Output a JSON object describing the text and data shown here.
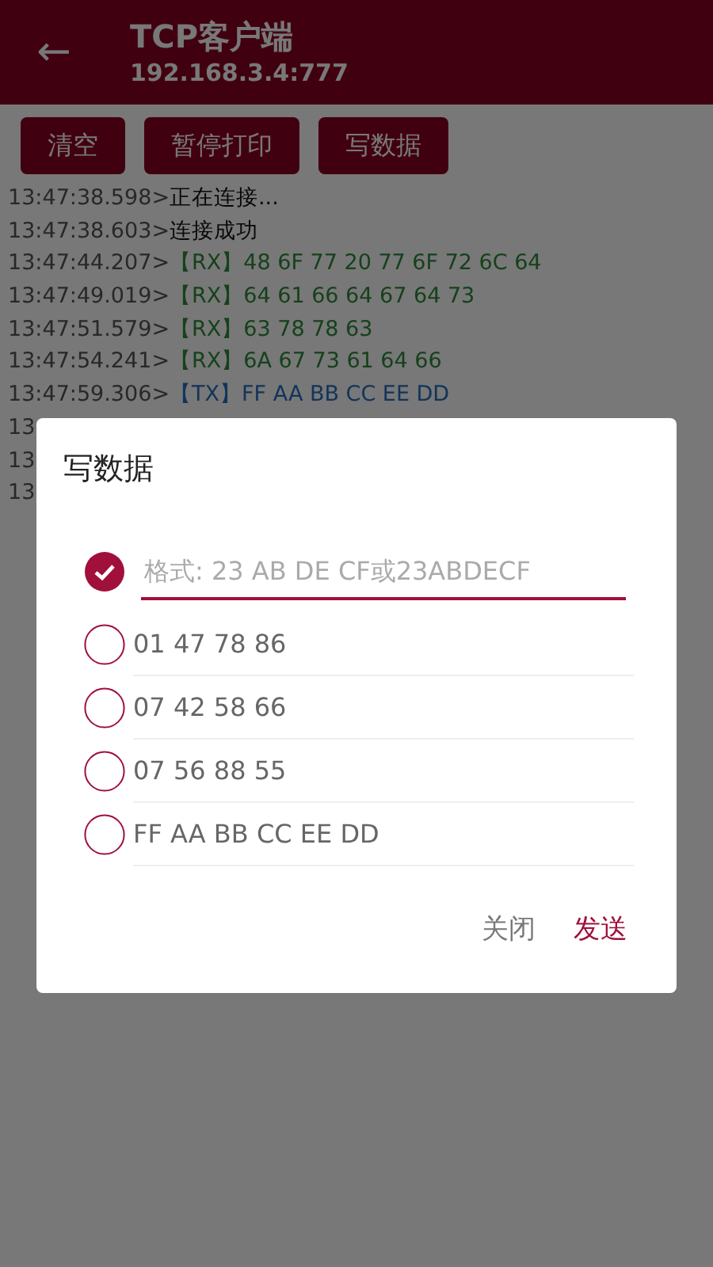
{
  "app_bar": {
    "back": "←",
    "title": "TCP客户端",
    "subtitle": "192.168.3.4:777"
  },
  "toolbar": [
    "清空",
    "暂停打印",
    "写数据"
  ],
  "log": [
    {
      "time": "13:47:38.598>",
      "message": "正在连接...",
      "kind": "info"
    },
    {
      "time": "13:47:38.603>",
      "message": "连接成功",
      "kind": "info"
    },
    {
      "time": "13:47:44.207>",
      "message": "【RX】48 6F 77 20 77 6F 72 6C 64",
      "kind": "rx"
    },
    {
      "time": "13:47:49.019>",
      "message": "【RX】64 61 66 64 67 64 73",
      "kind": "rx"
    },
    {
      "time": "13:47:51.579>",
      "message": "【RX】63 78 78 63",
      "kind": "rx"
    },
    {
      "time": "13:47:54.241>",
      "message": "【RX】6A 67 73 61 64 66",
      "kind": "rx"
    },
    {
      "time": "13:47:59.306>",
      "message": "【TX】FF AA BB CC EE DD",
      "kind": "tx"
    },
    {
      "time": "13"
    },
    {
      "time": "13"
    },
    {
      "time": "13"
    }
  ],
  "dialog": {
    "title": "写数据",
    "options": [
      {
        "kind": "input",
        "placeholder": "格式: 23 AB DE CF或23ABDECF",
        "selected": true
      },
      {
        "kind": "preset",
        "text": "01 47 78 86",
        "selected": false
      },
      {
        "kind": "preset",
        "text": "07 42 58 66",
        "selected": false
      },
      {
        "kind": "preset",
        "text": "07 56 88 55",
        "selected": false
      },
      {
        "kind": "preset",
        "text": "FF AA BB CC EE DD",
        "selected": false
      }
    ],
    "buttons": [
      {
        "label": "关闭",
        "kind": "cancel"
      },
      {
        "label": "发送",
        "kind": "confirm"
      }
    ]
  }
}
